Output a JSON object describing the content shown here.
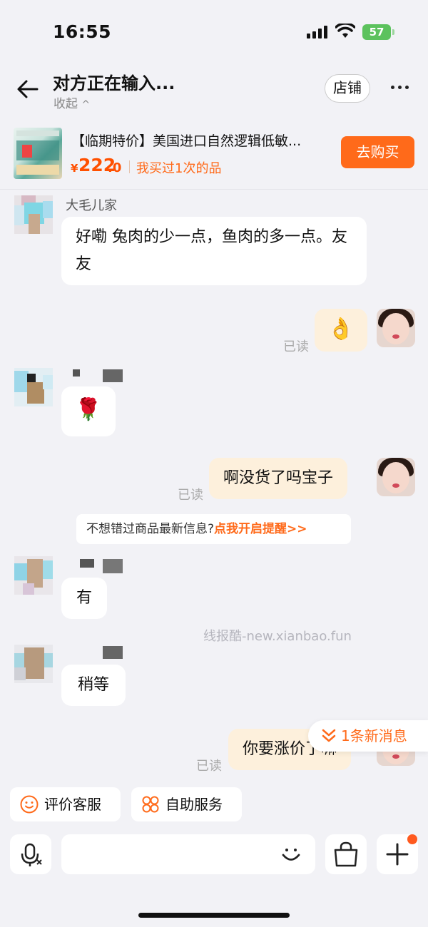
{
  "status": {
    "time": "16:55",
    "battery": "57"
  },
  "header": {
    "title": "对方正在输入...",
    "collapse": "收起",
    "collapse_chevron": "^",
    "store_label": "店铺",
    "more_icon": "more-icon"
  },
  "product": {
    "title": "【临期特价】美国进口自然逻辑低敏...",
    "price_symbol": "¥",
    "price_int": "222",
    "price_dec": ".0",
    "bought": "我买过1次的品",
    "buy_label": "去购买"
  },
  "messages": [
    {
      "side": "other",
      "sender": "大毛儿家",
      "text": "好嘞 兔肉的少一点，鱼肉的多一点。友友"
    },
    {
      "side": "me",
      "text": "👌",
      "read": "已读"
    },
    {
      "side": "other",
      "sender": "",
      "text": "🌹"
    },
    {
      "side": "me",
      "text": "啊没货了吗宝子",
      "read": "已读"
    },
    {
      "side": "other",
      "sender": "",
      "text": "有"
    },
    {
      "side": "other",
      "sender": "",
      "text": "稍等"
    },
    {
      "side": "me",
      "text": "你要涨价了嘛",
      "read": "已读"
    }
  ],
  "notice": {
    "text": "不想错过商品最新信息?",
    "link": "点我开启提醒>>"
  },
  "watermark": "线报酷-new.xianbao.fun",
  "new_message": "1条新消息",
  "quick_actions": [
    {
      "label": "评价客服",
      "icon": "smile-face-icon"
    },
    {
      "label": "自助服务",
      "icon": "grid-clover-icon"
    }
  ],
  "input": {
    "placeholder": ""
  },
  "colors": {
    "accent": "#ff6a1a",
    "price": "#ff5000",
    "my_bubble": "#fdf0dc",
    "background": "#f2f2f6"
  }
}
